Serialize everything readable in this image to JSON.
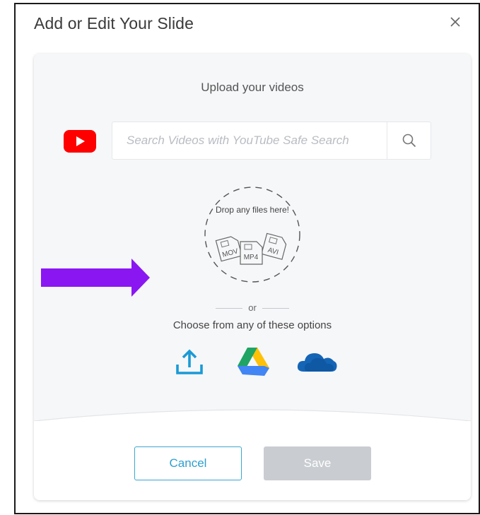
{
  "dialog": {
    "title": "Add or Edit Your Slide",
    "close_symbol": "×"
  },
  "upload": {
    "heading": "Upload your videos",
    "search_placeholder": "Search Videos with YouTube Safe Search",
    "search_value": "",
    "dropzone_text": "Drop any files here!",
    "file_types": [
      "MOV",
      "MP4",
      "AVI"
    ],
    "or_label": "or",
    "choose_text": "Choose from any of these options",
    "options": [
      "upload-icon",
      "google-drive-icon",
      "onedrive-icon"
    ]
  },
  "buttons": {
    "cancel": "Cancel",
    "save": "Save"
  },
  "colors": {
    "youtube_red": "#ff0000",
    "accent_blue": "#2e9fcf",
    "save_disabled": "#c9ccd1",
    "arrow_purple": "#8a17f2"
  }
}
